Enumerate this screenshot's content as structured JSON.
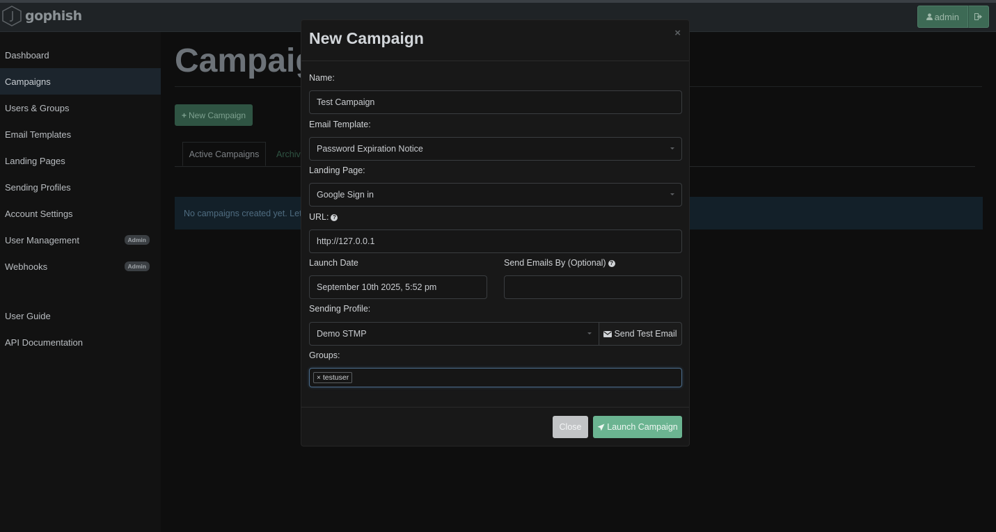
{
  "app": {
    "name": "gophish"
  },
  "header": {
    "user_label": "admin"
  },
  "sidebar": {
    "items": [
      {
        "label": "Dashboard"
      },
      {
        "label": "Campaigns"
      },
      {
        "label": "Users & Groups"
      },
      {
        "label": "Email Templates"
      },
      {
        "label": "Landing Pages"
      },
      {
        "label": "Sending Profiles"
      },
      {
        "label": "Account Settings"
      },
      {
        "label": "User Management",
        "badge": "Admin"
      },
      {
        "label": "Webhooks",
        "badge": "Admin"
      },
      {
        "label": "User Guide"
      },
      {
        "label": "API Documentation"
      }
    ],
    "active_index": 1
  },
  "main": {
    "title": "Campaig",
    "new_campaign_label": "New Campaign",
    "tabs": [
      {
        "label": "Active Campaigns"
      },
      {
        "label": "Archiv"
      }
    ],
    "alert": "No campaigns created yet. Let's"
  },
  "modal": {
    "title": "New Campaign",
    "close_symbol": "×",
    "name_label": "Name:",
    "name_value": "Test Campaign",
    "template_label": "Email Template:",
    "template_value": "Password Expiration Notice",
    "landing_label": "Landing Page:",
    "landing_value": "Google Sign in",
    "url_label": "URL:",
    "url_value": "http://127.0.0.1",
    "launch_date_label": "Launch Date",
    "launch_date_value": "September 10th 2025, 5:52 pm",
    "send_by_label": "Send Emails By (Optional)",
    "send_by_value": "",
    "profile_label": "Sending Profile:",
    "profile_value": "Demo STMP",
    "send_test_label": "Send Test Email",
    "groups_label": "Groups:",
    "groups": [
      "testuser"
    ],
    "close_button": "Close",
    "launch_button": "Launch Campaign"
  },
  "colors": {
    "accent_green": "#6bb491",
    "sidebar_active": "#1c252d",
    "modal_bg": "#181818"
  }
}
